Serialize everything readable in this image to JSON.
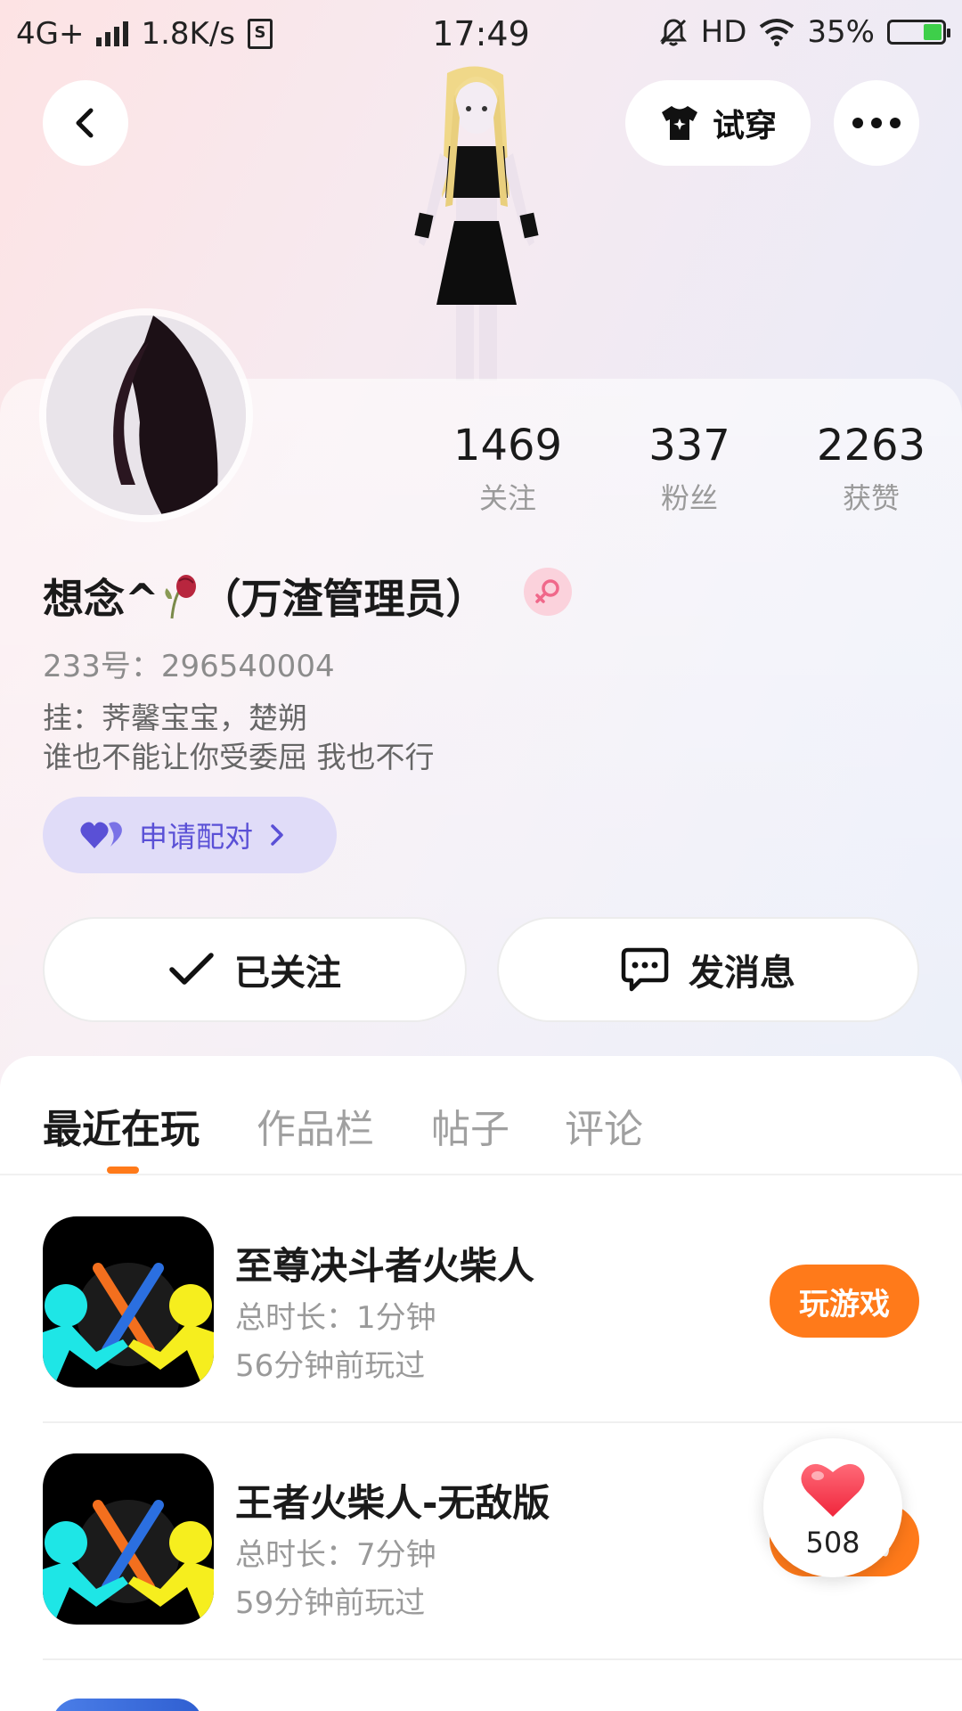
{
  "status_bar": {
    "network": "4G+",
    "speed": "1.8K/s",
    "time": "17:49",
    "hd": "HD",
    "battery_percent": "35%",
    "battery_level": 0.35
  },
  "top_nav": {
    "try_on_label": "试穿"
  },
  "profile": {
    "stats": [
      {
        "value": "1469",
        "label": "关注"
      },
      {
        "value": "337",
        "label": "粉丝"
      },
      {
        "value": "2263",
        "label": "获赞"
      }
    ],
    "nickname_prefix": "想念^",
    "nickname_suffix": "（万渣管理员）",
    "uid": "233号：296540004",
    "bio_line1": "挂：荠馨宝宝，楚朔",
    "bio_line2": "谁也不能让你受委屈 我也不行",
    "pair_label": "申请配对",
    "followed_label": "已关注",
    "message_label": "发消息"
  },
  "tabs": [
    {
      "label": "最近在玩",
      "active": true
    },
    {
      "label": "作品栏",
      "active": false
    },
    {
      "label": "帖子",
      "active": false
    },
    {
      "label": "评论",
      "active": false
    }
  ],
  "games": [
    {
      "title": "至尊决斗者火柴人",
      "duration": "总时长：1分钟",
      "last_played": "56分钟前玩过",
      "button": "玩游戏"
    },
    {
      "title": "王者火柴人-无敌版",
      "duration": "总时长：7分钟",
      "last_played": "59分钟前玩过",
      "button": "玩游戏"
    }
  ],
  "like_bubble": {
    "count": "508"
  },
  "colors": {
    "accent_orange": "#ff7a1a",
    "pair_purple": "#5a50d6",
    "gender_pink": "#f0688a"
  }
}
